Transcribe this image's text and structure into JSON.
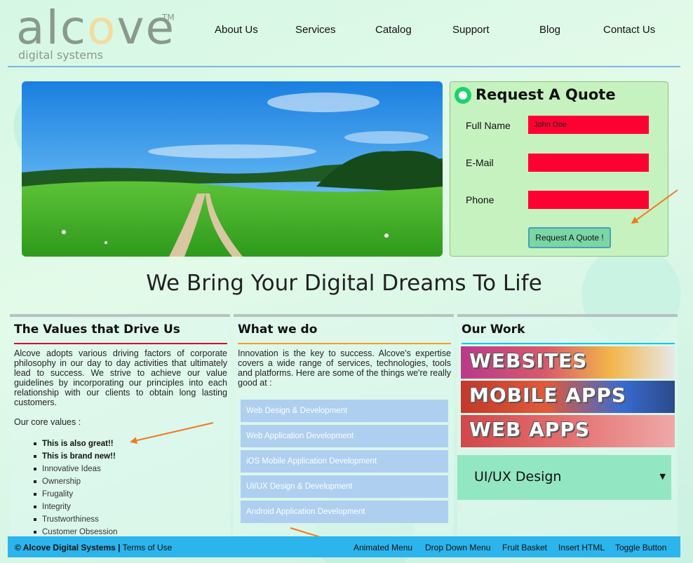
{
  "logo": {
    "word_a": "alc",
    "word_o": "o",
    "word_b": "ve",
    "tm": "TM",
    "subtitle": "digital systems"
  },
  "nav": [
    "About Us",
    "Services",
    "Catalog",
    "Support",
    "Blog",
    "Contact Us"
  ],
  "quote": {
    "title": "Request A Quote",
    "fields": [
      {
        "label": "Full Name",
        "value": "John Doe"
      },
      {
        "label": "E-Mail",
        "value": ""
      },
      {
        "label": "Phone",
        "value": ""
      }
    ],
    "button": "Request A Quote !",
    "input_color": "#ff0033"
  },
  "tagline": "We Bring Your Digital Dreams To Life",
  "values": {
    "title": "The Values that Drive Us",
    "intro": "Alcove adopts various driving factors of corporate philosophy in our day to day activities that ultimately lead to success. We strive to achieve our value guidelines by incorporating our principles into each relationship with our clients to obtain long lasting customers.",
    "core_label": "Our core values :",
    "items": [
      "This is also great!!",
      "This is brand new!!",
      "Innovative Ideas",
      "Ownership",
      "Frugality",
      "Integrity",
      "Trustworthiness",
      "Customer Obsession"
    ],
    "rule_color": "#d4002a"
  },
  "whatwedo": {
    "title": "What we do",
    "intro": "Innovation is the key to success. Alcove's expertise covers a wide range of services, technologies, tools and platforms. Here are some of the things we're really good at :",
    "services": [
      "Web Design & Development",
      "Web Application Development",
      "iOS Mobile Application Development",
      "UI/UX Design & Development",
      "Android Application Development"
    ],
    "rule_color": "#f0a020"
  },
  "ourwork": {
    "title": "Our Work",
    "tiles": [
      "WEBSITES",
      "MOBILE APPS",
      "WEB APPS"
    ],
    "dropdown_value": "UI/UX Design",
    "rule_color": "#10c8e8"
  },
  "footer": {
    "copyright": "© Alcove Digital Systems",
    "separator": "|",
    "terms": "Terms of Use",
    "links": [
      "Animated Menu",
      "Drop Down Menu",
      "Fruit Basket",
      "Insert HTML",
      "Toggle Button"
    ]
  }
}
